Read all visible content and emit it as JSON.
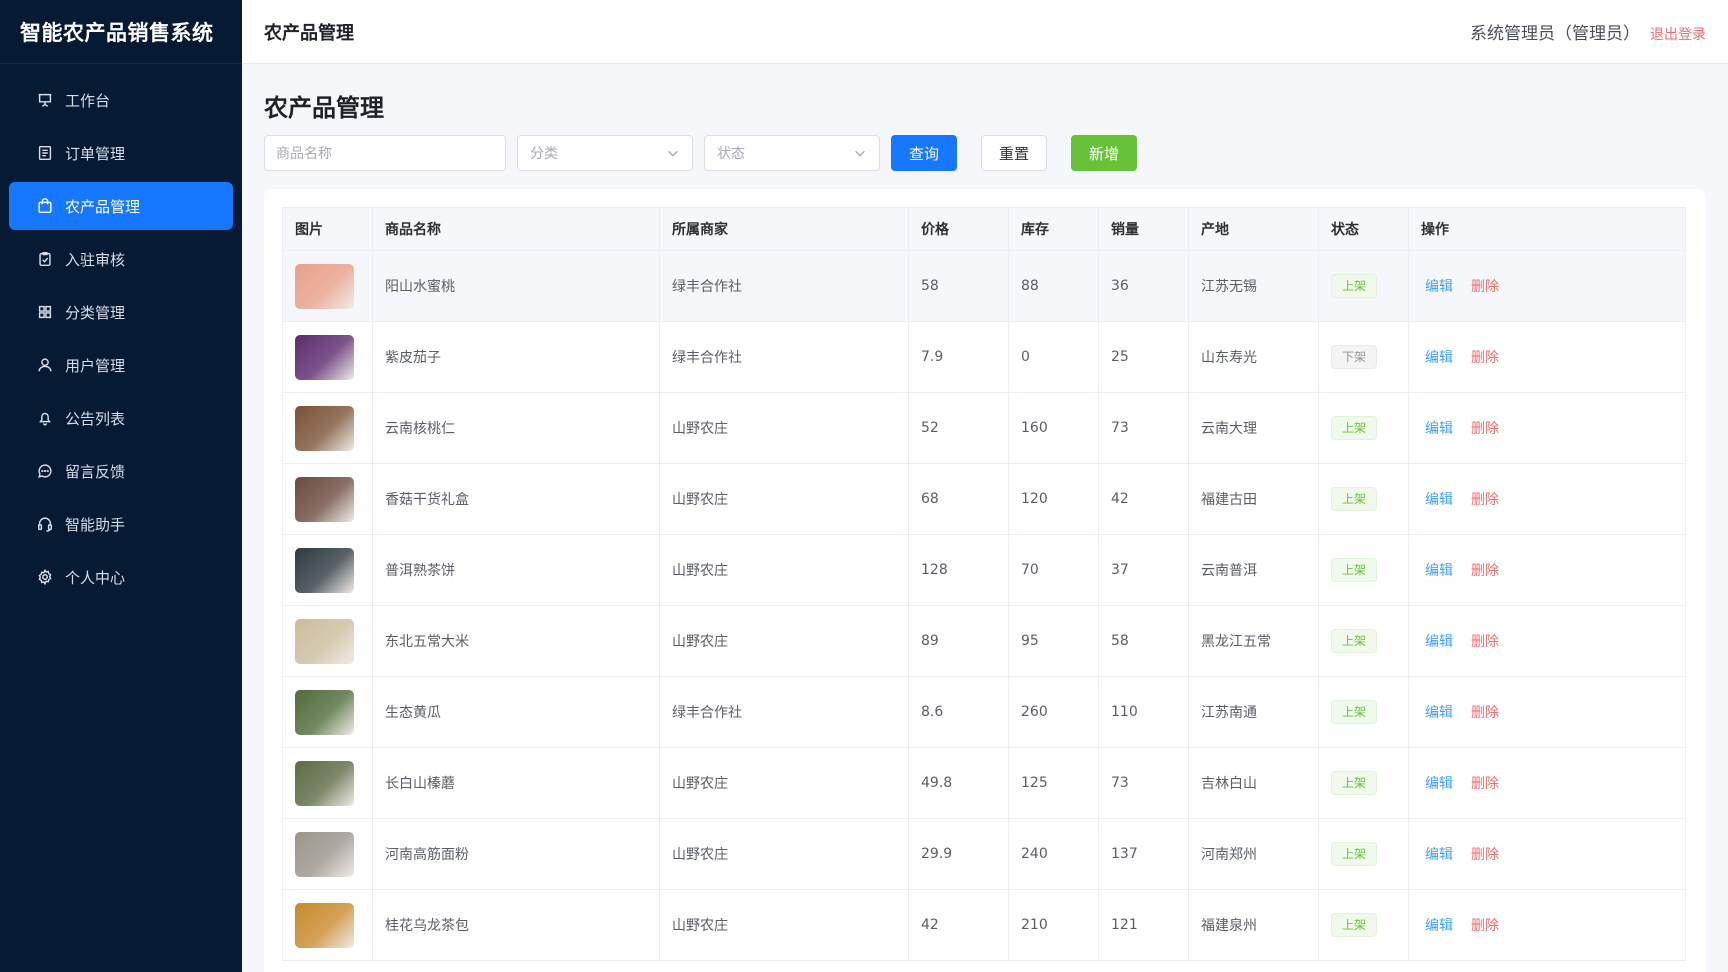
{
  "app": {
    "brand": "智能农产品销售系统"
  },
  "sidebar": {
    "items": [
      {
        "label": "工作台",
        "icon": "presentation-icon",
        "active": false
      },
      {
        "label": "订单管理",
        "icon": "document-list-icon",
        "active": false
      },
      {
        "label": "农产品管理",
        "icon": "shopping-bag-icon",
        "active": true
      },
      {
        "label": "入驻审核",
        "icon": "clipboard-check-icon",
        "active": false
      },
      {
        "label": "分类管理",
        "icon": "grid-icon",
        "active": false
      },
      {
        "label": "用户管理",
        "icon": "user-icon",
        "active": false
      },
      {
        "label": "公告列表",
        "icon": "bell-icon",
        "active": false
      },
      {
        "label": "留言反馈",
        "icon": "chat-bubble-icon",
        "active": false
      },
      {
        "label": "智能助手",
        "icon": "headset-icon",
        "active": false
      },
      {
        "label": "个人中心",
        "icon": "gear-icon",
        "active": false
      }
    ]
  },
  "header": {
    "title": "农产品管理",
    "user": "系统管理员（管理员）",
    "logout": "退出登录"
  },
  "main": {
    "title": "农产品管理",
    "search": {
      "name_placeholder": "商品名称",
      "category_placeholder": "分类",
      "status_placeholder": "状态"
    },
    "buttons": {
      "query": "查询",
      "reset": "重置",
      "add": "新增"
    },
    "table": {
      "columns": [
        "图片",
        "商品名称",
        "所属商家",
        "价格",
        "库存",
        "销量",
        "产地",
        "状态",
        "操作"
      ],
      "actions": {
        "edit": "编辑",
        "delete": "删除"
      },
      "rows": [
        {
          "name": "阳山水蜜桃",
          "merchant": "绿丰合作社",
          "price": "58",
          "stock": "88",
          "sales": "36",
          "origin": "江苏无锡",
          "status": "上架",
          "on": true,
          "thumb": "#e9a08a"
        },
        {
          "name": "紫皮茄子",
          "merchant": "绿丰合作社",
          "price": "7.9",
          "stock": "0",
          "sales": "25",
          "origin": "山东寿光",
          "status": "下架",
          "on": false,
          "thumb": "#5b2a6e"
        },
        {
          "name": "云南核桃仁",
          "merchant": "山野农庄",
          "price": "52",
          "stock": "160",
          "sales": "73",
          "origin": "云南大理",
          "status": "上架",
          "on": true,
          "thumb": "#7a5236"
        },
        {
          "name": "香菇干货礼盒",
          "merchant": "山野农庄",
          "price": "68",
          "stock": "120",
          "sales": "42",
          "origin": "福建古田",
          "status": "上架",
          "on": true,
          "thumb": "#6b4a3e"
        },
        {
          "name": "普洱熟茶饼",
          "merchant": "山野农庄",
          "price": "128",
          "stock": "70",
          "sales": "37",
          "origin": "云南普洱",
          "status": "上架",
          "on": true,
          "thumb": "#2e3a40"
        },
        {
          "name": "东北五常大米",
          "merchant": "山野农庄",
          "price": "89",
          "stock": "95",
          "sales": "58",
          "origin": "黑龙江五常",
          "status": "上架",
          "on": true,
          "thumb": "#cbbd9e"
        },
        {
          "name": "生态黄瓜",
          "merchant": "绿丰合作社",
          "price": "8.6",
          "stock": "260",
          "sales": "110",
          "origin": "江苏南通",
          "status": "上架",
          "on": true,
          "thumb": "#4f6b3a"
        },
        {
          "name": "长白山榛蘑",
          "merchant": "山野农庄",
          "price": "49.8",
          "stock": "125",
          "sales": "73",
          "origin": "吉林白山",
          "status": "上架",
          "on": true,
          "thumb": "#5d6a45"
        },
        {
          "name": "河南高筋面粉",
          "merchant": "山野农庄",
          "price": "29.9",
          "stock": "240",
          "sales": "137",
          "origin": "河南郑州",
          "status": "上架",
          "on": true,
          "thumb": "#9a948a"
        },
        {
          "name": "桂花乌龙茶包",
          "merchant": "山野农庄",
          "price": "42",
          "stock": "210",
          "sales": "121",
          "origin": "福建泉州",
          "status": "上架",
          "on": true,
          "thumb": "#c8892c"
        }
      ]
    }
  },
  "colors": {
    "sidebar_bg": "#071a33",
    "primary": "#1677ff",
    "success": "#67c23a",
    "danger": "#f56c6c"
  }
}
